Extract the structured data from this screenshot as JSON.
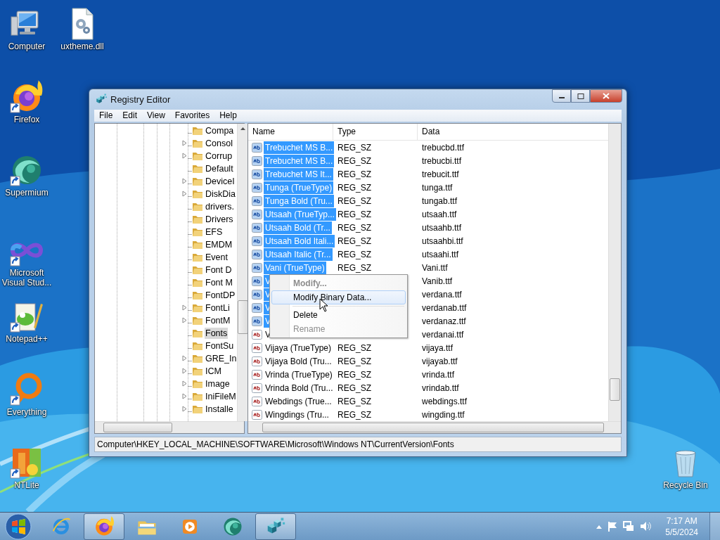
{
  "desktop_icons": [
    {
      "label": "Computer",
      "kind": "computer",
      "shortcut": false
    },
    {
      "label": "uxtheme.dll",
      "kind": "dll",
      "shortcut": false
    },
    {
      "label": "Firefox",
      "kind": "firefox",
      "shortcut": true
    },
    {
      "label": "Supermium",
      "kind": "supermium",
      "shortcut": true
    },
    {
      "label": "Microsoft Visual Stud...",
      "kind": "visualstudio",
      "shortcut": true
    },
    {
      "label": "Notepad++",
      "kind": "notepad",
      "shortcut": true
    },
    {
      "label": "Everything",
      "kind": "everything",
      "shortcut": true
    },
    {
      "label": "NTLite",
      "kind": "ntlite",
      "shortcut": true
    },
    {
      "label": "Recycle Bin",
      "kind": "recycle",
      "shortcut": false
    }
  ],
  "window": {
    "title": "Registry Editor",
    "menu": [
      "File",
      "Edit",
      "View",
      "Favorites",
      "Help"
    ],
    "tree": [
      {
        "label": "Compa",
        "expandable": false,
        "selected": false
      },
      {
        "label": "Consol",
        "expandable": true,
        "selected": false
      },
      {
        "label": "Corrup",
        "expandable": true,
        "selected": false
      },
      {
        "label": "Default",
        "expandable": false,
        "selected": false
      },
      {
        "label": "DeviceI",
        "expandable": true,
        "selected": false
      },
      {
        "label": "DiskDia",
        "expandable": true,
        "selected": false
      },
      {
        "label": "drivers.",
        "expandable": false,
        "selected": false
      },
      {
        "label": "Drivers",
        "expandable": false,
        "selected": false
      },
      {
        "label": "EFS",
        "expandable": false,
        "selected": false
      },
      {
        "label": "EMDM",
        "expandable": false,
        "selected": false
      },
      {
        "label": "Event",
        "expandable": false,
        "selected": false
      },
      {
        "label": "Font D",
        "expandable": false,
        "selected": false
      },
      {
        "label": "Font M",
        "expandable": false,
        "selected": false
      },
      {
        "label": "FontDP",
        "expandable": false,
        "selected": false
      },
      {
        "label": "FontLi",
        "expandable": true,
        "selected": false
      },
      {
        "label": "FontM",
        "expandable": true,
        "selected": false
      },
      {
        "label": "Fonts",
        "expandable": false,
        "selected": true
      },
      {
        "label": "FontSu",
        "expandable": false,
        "selected": false
      },
      {
        "label": "GRE_In",
        "expandable": true,
        "selected": false
      },
      {
        "label": "ICM",
        "expandable": true,
        "selected": false
      },
      {
        "label": "Image",
        "expandable": true,
        "selected": false
      },
      {
        "label": "IniFileM",
        "expandable": true,
        "selected": false
      },
      {
        "label": "Installe",
        "expandable": true,
        "selected": false
      }
    ],
    "columns": [
      "Name",
      "Type",
      "Data"
    ],
    "rows": [
      {
        "name": "Trebuchet MS B...",
        "type": "REG_SZ",
        "data": "trebucbd.ttf",
        "selected": true
      },
      {
        "name": "Trebuchet MS B...",
        "type": "REG_SZ",
        "data": "trebucbi.ttf",
        "selected": true
      },
      {
        "name": "Trebuchet MS It...",
        "type": "REG_SZ",
        "data": "trebucit.ttf",
        "selected": true
      },
      {
        "name": "Tunga (TrueType)",
        "type": "REG_SZ",
        "data": "tunga.ttf",
        "selected": true
      },
      {
        "name": "Tunga Bold (Tru...",
        "type": "REG_SZ",
        "data": "tungab.ttf",
        "selected": true
      },
      {
        "name": "Utsaah (TrueTyp...",
        "type": "REG_SZ",
        "data": "utsaah.ttf",
        "selected": true
      },
      {
        "name": "Utsaah Bold (Tr...",
        "type": "REG_SZ",
        "data": "utsaahb.ttf",
        "selected": true
      },
      {
        "name": "Utsaah Bold Itali...",
        "type": "REG_SZ",
        "data": "utsaahbi.ttf",
        "selected": true
      },
      {
        "name": "Utsaah Italic (Tr...",
        "type": "REG_SZ",
        "data": "utsaahi.ttf",
        "selected": true
      },
      {
        "name": "Vani (TrueType)",
        "type": "REG_SZ",
        "data": "Vani.ttf",
        "selected": true
      },
      {
        "name": "V",
        "data": "Vanib.ttf",
        "selected": true
      },
      {
        "name": "V",
        "data": "verdana.ttf",
        "selected": true
      },
      {
        "name": "V",
        "data": "verdanab.ttf",
        "selected": true
      },
      {
        "name": "V",
        "data": "verdanaz.ttf",
        "selected": true
      },
      {
        "name": "V",
        "data": "verdanai.ttf",
        "selected": false
      },
      {
        "name": "Vijaya (TrueType)",
        "type": "REG_SZ",
        "data": "vijaya.ttf",
        "selected": false
      },
      {
        "name": "Vijaya Bold (Tru...",
        "type": "REG_SZ",
        "data": "vijayab.ttf",
        "selected": false
      },
      {
        "name": "Vrinda (TrueType)",
        "type": "REG_SZ",
        "data": "vrinda.ttf",
        "selected": false
      },
      {
        "name": "Vrinda Bold (Tru...",
        "type": "REG_SZ",
        "data": "vrindab.ttf",
        "selected": false
      },
      {
        "name": "Webdings (True...",
        "type": "REG_SZ",
        "data": "webdings.ttf",
        "selected": false
      },
      {
        "name": "Wingdings (Tru...",
        "type": "REG_SZ",
        "data": "wingding.ttf",
        "selected": false
      }
    ],
    "context_menu": [
      {
        "label": "Modify...",
        "default": true,
        "disabled": true,
        "selected": false
      },
      {
        "label": "Modify Binary Data...",
        "default": false,
        "disabled": false,
        "selected": true
      },
      {
        "kind": "separator"
      },
      {
        "label": "Delete",
        "default": false,
        "disabled": false,
        "selected": false
      },
      {
        "label": "Rename",
        "default": false,
        "disabled": true,
        "selected": false
      }
    ],
    "status": "Computer\\HKEY_LOCAL_MACHINE\\SOFTWARE\\Microsoft\\Windows NT\\CurrentVersion\\Fonts"
  },
  "taskbar": {
    "buttons": [
      {
        "kind": "ie",
        "selected": false
      },
      {
        "kind": "firefox",
        "selected": true
      },
      {
        "kind": "explorer",
        "selected": false
      },
      {
        "kind": "media",
        "selected": false
      },
      {
        "kind": "supermium",
        "selected": false
      },
      {
        "kind": "regedit",
        "selected": true
      }
    ],
    "time": "7:17 AM",
    "date": "5/5/2024"
  }
}
